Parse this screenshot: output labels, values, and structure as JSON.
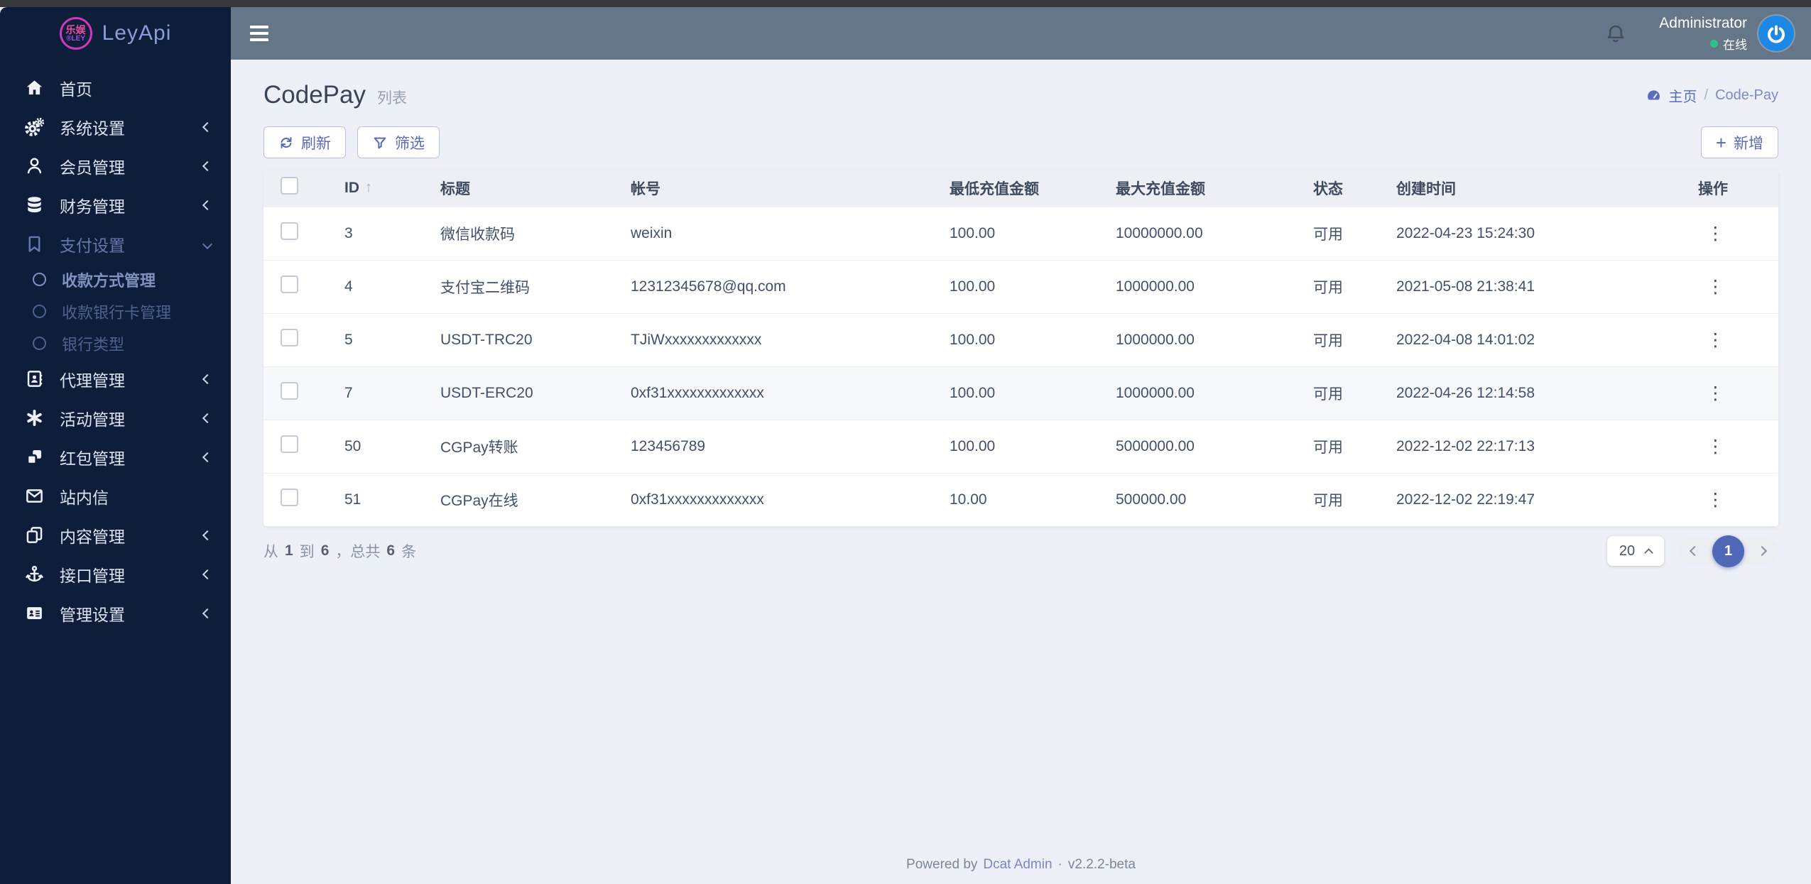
{
  "brand": {
    "name": "LeyApi",
    "badge_line1": "乐娱",
    "badge_line2": "®LEY"
  },
  "topbar": {
    "user_name": "Administrator",
    "status_label": "在线"
  },
  "sidebar": {
    "items": [
      {
        "label": "首页",
        "icon": "home-icon"
      },
      {
        "label": "系统设置",
        "icon": "cogs-icon"
      },
      {
        "label": "会员管理",
        "icon": "user-icon"
      },
      {
        "label": "财务管理",
        "icon": "database-icon"
      },
      {
        "label": "支付设置",
        "icon": "bookmark-icon",
        "expanded": true,
        "children": [
          {
            "label": "收款方式管理",
            "active": true
          },
          {
            "label": "收款银行卡管理",
            "active": false
          },
          {
            "label": "银行类型",
            "active": false
          }
        ]
      },
      {
        "label": "代理管理",
        "icon": "address-book-icon"
      },
      {
        "label": "活动管理",
        "icon": "burst-icon"
      },
      {
        "label": "红包管理",
        "icon": "boxes-icon"
      },
      {
        "label": "站内信",
        "icon": "envelope-icon"
      },
      {
        "label": "内容管理",
        "icon": "copy-icon"
      },
      {
        "label": "接口管理",
        "icon": "anchor-icon"
      },
      {
        "label": "管理设置",
        "icon": "id-card-icon"
      }
    ]
  },
  "page": {
    "title": "CodePay",
    "subtitle": "列表",
    "breadcrumb_home": "主页",
    "breadcrumb_sep": "/",
    "breadcrumb_current": "Code-Pay"
  },
  "toolbar": {
    "refresh_label": "刷新",
    "filter_label": "筛选",
    "add_label": "新增",
    "add_icon": "+"
  },
  "table": {
    "columns": [
      "ID",
      "标题",
      "帐号",
      "最低充值金额",
      "最大充值金额",
      "状态",
      "创建时间",
      "操作"
    ],
    "icons": {
      "sort_asc": "↑",
      "more": "⋮"
    },
    "rows": [
      {
        "id": "3",
        "title": "微信收款码",
        "account": "weixin",
        "min": "100.00",
        "max": "10000000.00",
        "status": "可用",
        "created": "2022-04-23 15:24:30"
      },
      {
        "id": "4",
        "title": "支付宝二维码",
        "account": "12312345678@qq.com",
        "min": "100.00",
        "max": "1000000.00",
        "status": "可用",
        "created": "2021-05-08 21:38:41"
      },
      {
        "id": "5",
        "title": "USDT-TRC20",
        "account": "TJiWxxxxxxxxxxxxx",
        "min": "100.00",
        "max": "1000000.00",
        "status": "可用",
        "created": "2022-04-08 14:01:02"
      },
      {
        "id": "7",
        "title": "USDT-ERC20",
        "account": "0xf31xxxxxxxxxxxxx",
        "min": "100.00",
        "max": "1000000.00",
        "status": "可用",
        "created": "2022-04-26 12:14:58"
      },
      {
        "id": "50",
        "title": "CGPay转账",
        "account": "123456789",
        "min": "100.00",
        "max": "5000000.00",
        "status": "可用",
        "created": "2022-12-02 22:17:13"
      },
      {
        "id": "51",
        "title": "CGPay在线",
        "account": "0xf31xxxxxxxxxxxxx",
        "min": "10.00",
        "max": "500000.00",
        "status": "可用",
        "created": "2022-12-02 22:19:47"
      }
    ]
  },
  "pagination": {
    "from_label": "从",
    "from": "1",
    "to_label": "到",
    "to": "6",
    "total_label": "，总共",
    "total": "6",
    "unit_label": "条",
    "per_page": "20",
    "current_page": "1"
  },
  "footer": {
    "powered_by": "Powered by",
    "brand_link": "Dcat Admin",
    "separator": "·",
    "version": "v2.2.2-beta"
  },
  "colors": {
    "primary": "#5a6ab4",
    "sidebar_bg": "#0e1d3a",
    "header_bg": "#647687",
    "content_bg": "#edf0f6",
    "online_green": "#2ec08a",
    "avatar_blue": "#1d87e4",
    "pager_active": "#4f69b8"
  }
}
